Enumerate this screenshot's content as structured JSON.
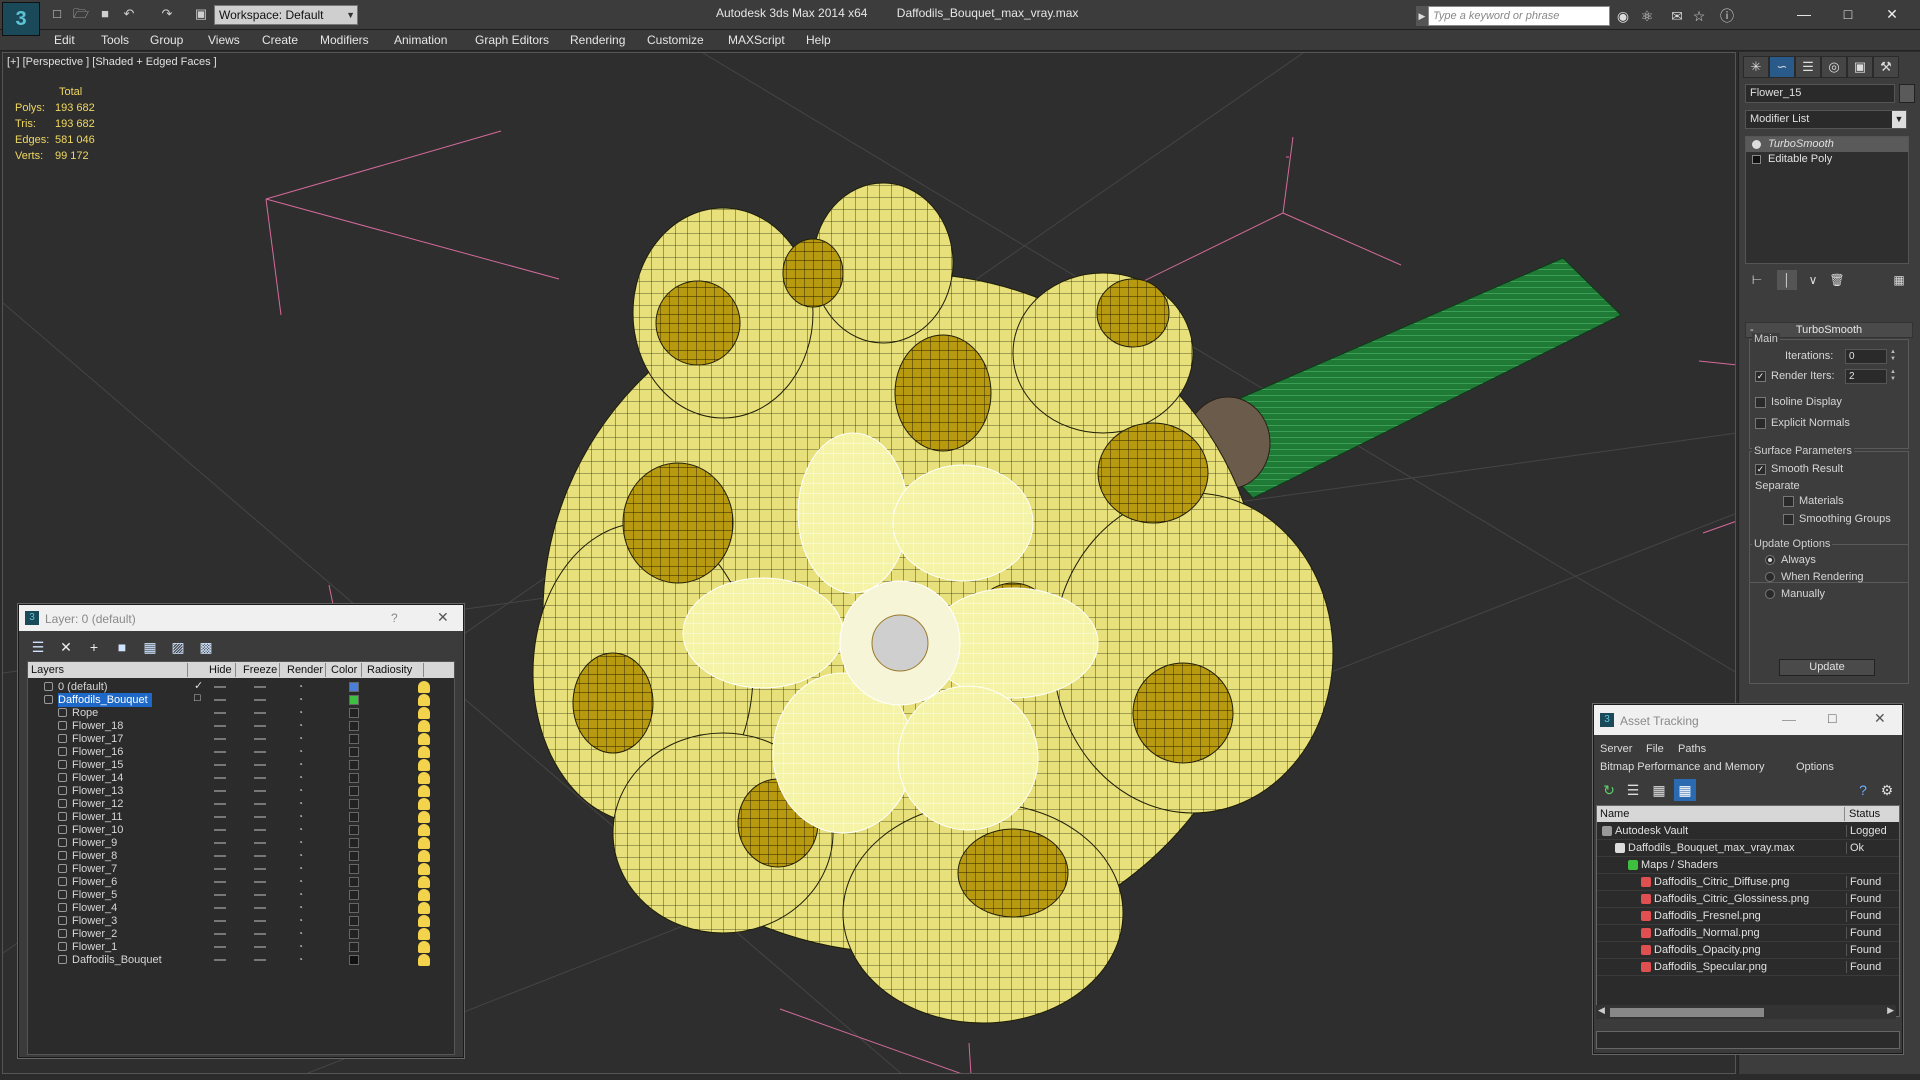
{
  "title_bar": {
    "app_name": "Autodesk 3ds Max  2014 x64",
    "file_name": "Daffodils_Bouquet_max_vray.max",
    "workspace": "Workspace: Default",
    "search_placeholder": "Type a keyword or phrase"
  },
  "menu": [
    "Edit",
    "Tools",
    "Group",
    "Views",
    "Create",
    "Modifiers",
    "Animation",
    "Graph Editors",
    "Rendering",
    "Customize",
    "MAXScript",
    "Help"
  ],
  "viewport": {
    "label": "[+] [Perspective ] [Shaded + Edged Faces ]",
    "stats_header": "Total",
    "stats": [
      {
        "label": "Polys:",
        "value": "193 682"
      },
      {
        "label": "Tris:",
        "value": "193 682"
      },
      {
        "label": "Edges:",
        "value": "581 046"
      },
      {
        "label": "Verts:",
        "value": "99 172"
      }
    ]
  },
  "command_panel": {
    "object_name": "Flower_15",
    "modifier_list": "Modifier List",
    "stack": [
      "TurboSmooth",
      "Editable Poly"
    ],
    "rollout_title": "TurboSmooth",
    "main_group": "Main",
    "iterations_label": "Iterations:",
    "iterations_value": "0",
    "render_iters_label": "Render Iters:",
    "render_iters_value": "2",
    "isoline_label": "Isoline Display",
    "explicit_normals_label": "Explicit Normals",
    "surface_group": "Surface Parameters",
    "smooth_result_label": "Smooth Result",
    "separate_label": "Separate",
    "materials_label": "Materials",
    "smoothing_groups_label": "Smoothing Groups",
    "update_group": "Update Options",
    "always_label": "Always",
    "when_rendering_label": "When Rendering",
    "manually_label": "Manually",
    "update_button": "Update"
  },
  "layer_dialog": {
    "title": "Layer: 0 (default)",
    "help": "?",
    "columns": [
      "Layers",
      "Hide",
      "Freeze",
      "Render",
      "Color",
      "Radiosity"
    ],
    "rows": [
      {
        "name": "0 (default)",
        "color": "#4a7fd8",
        "level": 0
      },
      {
        "name": "Daffodils_Bouquet",
        "color": "#3fbf3f",
        "level": 0
      },
      {
        "name": "Rope",
        "color": "#222222",
        "level": 1
      },
      {
        "name": "Flower_18",
        "color": "#222222",
        "level": 1
      },
      {
        "name": "Flower_17",
        "color": "#222222",
        "level": 1
      },
      {
        "name": "Flower_16",
        "color": "#222222",
        "level": 1
      },
      {
        "name": "Flower_15",
        "color": "#222222",
        "level": 1
      },
      {
        "name": "Flower_14",
        "color": "#222222",
        "level": 1
      },
      {
        "name": "Flower_13",
        "color": "#222222",
        "level": 1
      },
      {
        "name": "Flower_12",
        "color": "#222222",
        "level": 1
      },
      {
        "name": "Flower_11",
        "color": "#222222",
        "level": 1
      },
      {
        "name": "Flower_10",
        "color": "#222222",
        "level": 1
      },
      {
        "name": "Flower_9",
        "color": "#222222",
        "level": 1
      },
      {
        "name": "Flower_8",
        "color": "#222222",
        "level": 1
      },
      {
        "name": "Flower_7",
        "color": "#222222",
        "level": 1
      },
      {
        "name": "Flower_6",
        "color": "#222222",
        "level": 1
      },
      {
        "name": "Flower_5",
        "color": "#222222",
        "level": 1
      },
      {
        "name": "Flower_4",
        "color": "#222222",
        "level": 1
      },
      {
        "name": "Flower_3",
        "color": "#222222",
        "level": 1
      },
      {
        "name": "Flower_2",
        "color": "#222222",
        "level": 1
      },
      {
        "name": "Flower_1",
        "color": "#222222",
        "level": 1
      },
      {
        "name": "Daffodils_Bouquet",
        "color": "#111111",
        "level": 1
      }
    ]
  },
  "asset_dialog": {
    "title": "Asset Tracking",
    "menu_row1": [
      "Server",
      "File",
      "Paths"
    ],
    "menu_row2": [
      "Bitmap Performance and Memory",
      "Options"
    ],
    "columns": [
      "Name",
      "Status"
    ],
    "rows": [
      {
        "name": "Autodesk Vault",
        "status": "Logged",
        "level": 0
      },
      {
        "name": "Daffodils_Bouquet_max_vray.max",
        "status": "Ok",
        "level": 1
      },
      {
        "name": "Maps / Shaders",
        "status": "",
        "level": 2
      },
      {
        "name": "Daffodils_Citric_Diffuse.png",
        "status": "Found",
        "level": 3
      },
      {
        "name": "Daffodils_Citric_Glossiness.png",
        "status": "Found",
        "level": 3
      },
      {
        "name": "Daffodils_Fresnel.png",
        "status": "Found",
        "level": 3
      },
      {
        "name": "Daffodils_Normal.png",
        "status": "Found",
        "level": 3
      },
      {
        "name": "Daffodils_Opacity.png",
        "status": "Found",
        "level": 3
      },
      {
        "name": "Daffodils_Specular.png",
        "status": "Found",
        "level": 3
      }
    ]
  }
}
